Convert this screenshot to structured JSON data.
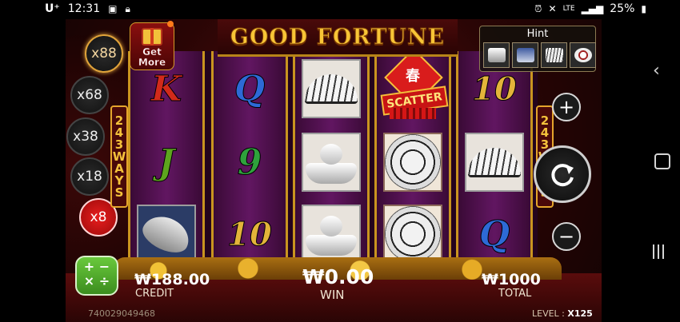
{
  "status_bar": {
    "carrier": "U⁺",
    "time": "12:31",
    "network": "LTE",
    "battery": "25%"
  },
  "game": {
    "title": "GOOD FORTUNE",
    "get_more_label": "Get More",
    "hint_label": "Hint",
    "ways_label": "243 WAYS",
    "multipliers": [
      {
        "label": "x88",
        "state": "active"
      },
      {
        "label": "x68",
        "state": "normal"
      },
      {
        "label": "x38",
        "state": "normal"
      },
      {
        "label": "x18",
        "state": "normal"
      },
      {
        "label": "x8",
        "state": "current"
      }
    ],
    "reels": [
      [
        "K",
        "J",
        "fish"
      ],
      [
        "Q",
        "9",
        "10"
      ],
      [
        "fan",
        "ingot",
        "ingot"
      ],
      [
        "scatter",
        "coin",
        "coin"
      ],
      [
        "10",
        "fan",
        "Q"
      ]
    ],
    "scatter_text": "SCATTER",
    "scatter_char": "春",
    "hint_symbols": [
      "ingot-icon",
      "fish-icon",
      "fan-icon",
      "coin-icon"
    ],
    "calc_ops": "+ −\n× ÷",
    "credit": {
      "value": "₩188.00",
      "label": "CREDIT"
    },
    "win": {
      "value": "₩0.00",
      "label": "WIN"
    },
    "total": {
      "value": "₩1000",
      "label": "TOTAL"
    },
    "game_id": "740029049468",
    "level": {
      "label": "LEVEL :",
      "value": "X125"
    }
  },
  "colors": {
    "title_gold": "#f8c536",
    "reel_purple": "#611661",
    "frame_gold": "#c9941f",
    "multiplier_red": "#e81e1e",
    "calc_green": "#6ac93c"
  }
}
